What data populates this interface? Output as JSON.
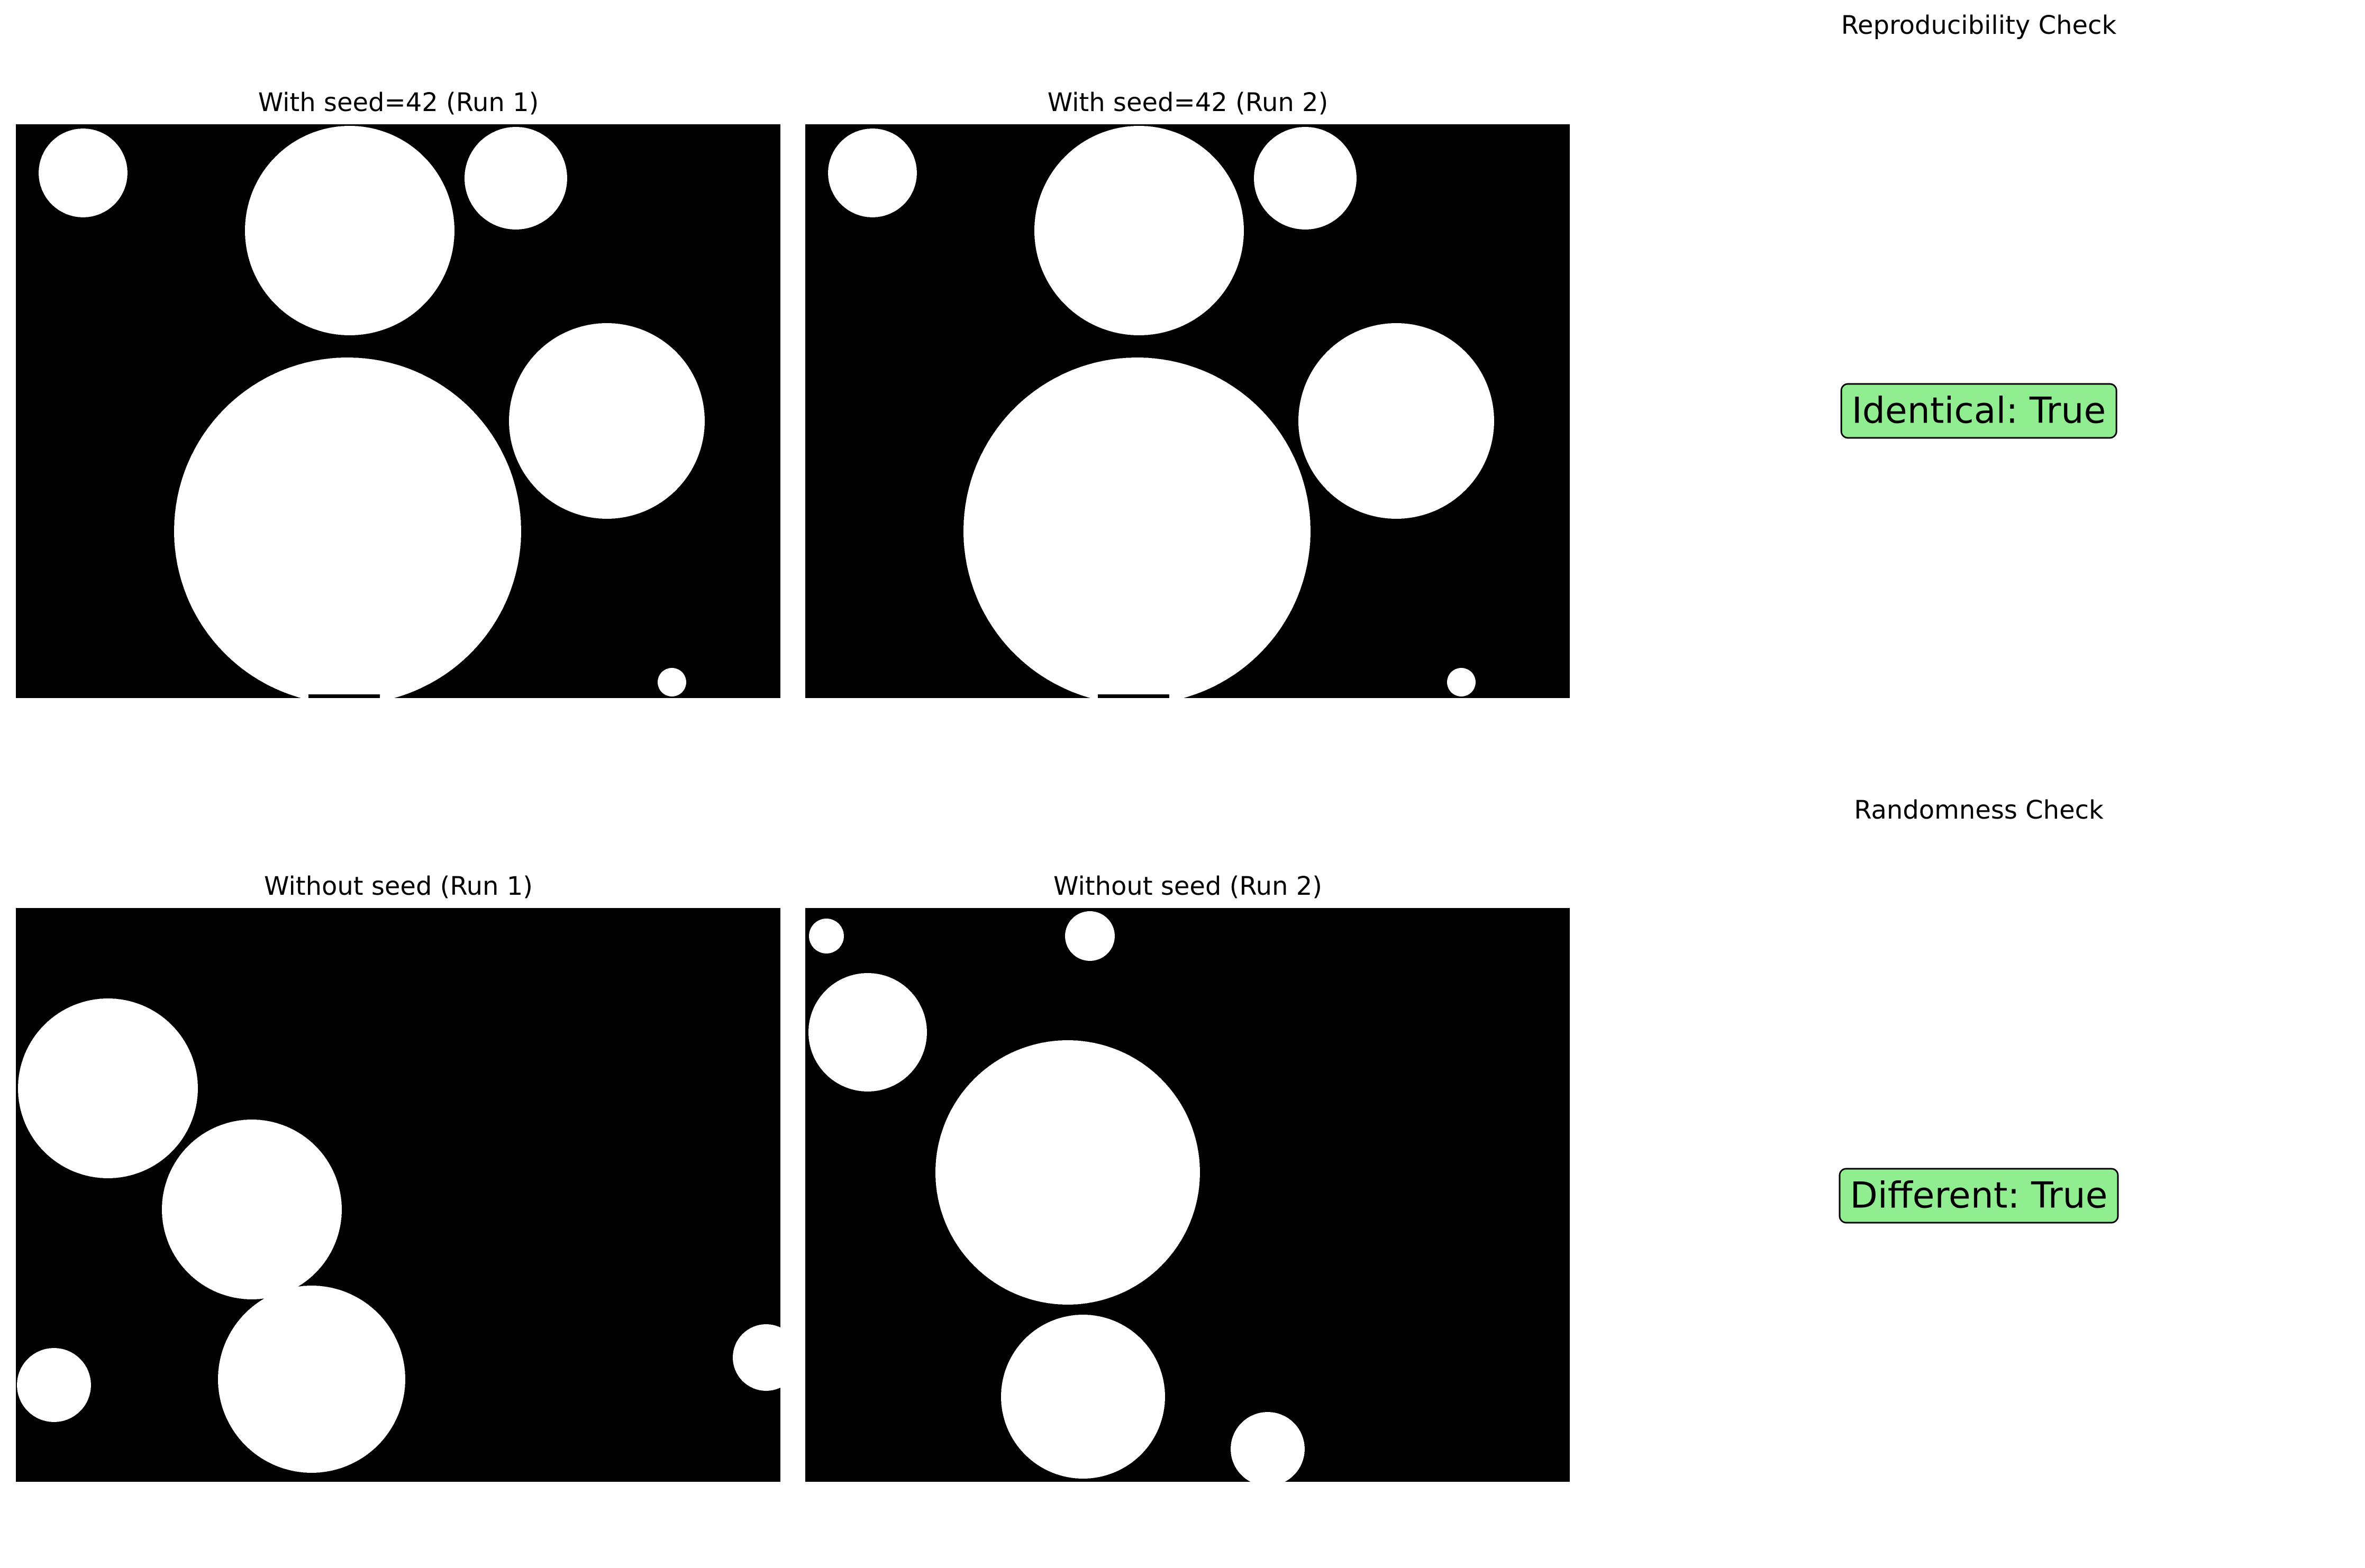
{
  "panels": {
    "seed_run1": {
      "title": "With seed=42 (Run 1)"
    },
    "seed_run2": {
      "title": "With seed=42 (Run 2)"
    },
    "noseed_run1": {
      "title": "Without seed (Run 1)"
    },
    "noseed_run2": {
      "title": "Without seed (Run 2)"
    }
  },
  "checks": {
    "reproducibility": {
      "title": "Reproducibility Check",
      "result": "Identical: True"
    },
    "randomness": {
      "title": "Randomness Check",
      "result": "Different: True"
    }
  },
  "colors": {
    "background": "#000000",
    "circle": "#ffffff",
    "badge_fill": "#90ee90"
  }
}
